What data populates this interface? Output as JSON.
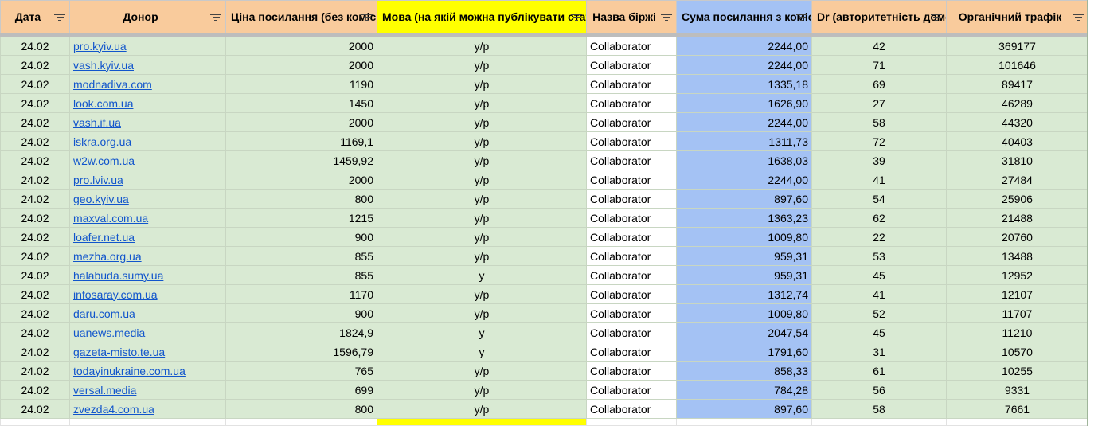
{
  "headers": [
    "Дата",
    "Донор",
    "Ціна посилання (без комісії біржі)",
    "Мова (на якій можна публікувати статті)",
    "Назва біржі",
    "Сума посилання з комісією біржі",
    "Dr (авторитетність домену)",
    "Органічний трафік"
  ],
  "header_colors": {
    "default": "#f9cb9c",
    "language": "#ffff00",
    "sum": "#a4c2f4"
  },
  "icons": {
    "column_filter": "filter-icon"
  },
  "rows": [
    [
      "24.02",
      "pro.kyiv.ua",
      "2000",
      "у/р",
      "Collaborator",
      "2244,00",
      "42",
      "369177"
    ],
    [
      "24.02",
      "vash.kyiv.ua",
      "2000",
      "у/р",
      "Collaborator",
      "2244,00",
      "71",
      "101646"
    ],
    [
      "24.02",
      "modnadiva.com",
      "1190",
      "у/р",
      "Collaborator",
      "1335,18",
      "69",
      "89417"
    ],
    [
      "24.02",
      "look.com.ua",
      "1450",
      "у/р",
      "Collaborator",
      "1626,90",
      "27",
      "46289"
    ],
    [
      "24.02",
      "vash.if.ua",
      "2000",
      "у/р",
      "Collaborator",
      "2244,00",
      "58",
      "44320"
    ],
    [
      "24.02",
      "iskra.org.ua",
      "1169,1",
      "у/р",
      "Collaborator",
      "1311,73",
      "72",
      "40403"
    ],
    [
      "24.02",
      "w2w.com.ua",
      "1459,92",
      "у/р",
      "Collaborator",
      "1638,03",
      "39",
      "31810"
    ],
    [
      "24.02",
      "pro.lviv.ua",
      "2000",
      "у/р",
      "Collaborator",
      "2244,00",
      "41",
      "27484"
    ],
    [
      "24.02",
      "geo.kyiv.ua",
      "800",
      "у/р",
      "Collaborator",
      "897,60",
      "54",
      "25906"
    ],
    [
      "24.02",
      "maxval.com.ua",
      "1215",
      "у/р",
      "Collaborator",
      "1363,23",
      "62",
      "21488"
    ],
    [
      "24.02",
      "loafer.net.ua",
      "900",
      "у/р",
      "Collaborator",
      "1009,80",
      "22",
      "20760"
    ],
    [
      "24.02",
      "mezha.org.ua",
      "855",
      "у/р",
      "Collaborator",
      "959,31",
      "53",
      "13488"
    ],
    [
      "24.02",
      "halabuda.sumy.ua",
      "855",
      "у",
      "Collaborator",
      "959,31",
      "45",
      "12952"
    ],
    [
      "24.02",
      "infosaray.com.ua",
      "1170",
      "у/р",
      "Collaborator",
      "1312,74",
      "41",
      "12107"
    ],
    [
      "24.02",
      "daru.com.ua",
      "900",
      "у/р",
      "Collaborator",
      "1009,80",
      "52",
      "11707"
    ],
    [
      "24.02",
      "uanews.media",
      "1824,9",
      "у",
      "Collaborator",
      "2047,54",
      "45",
      "11210"
    ],
    [
      "24.02",
      "gazeta-misto.te.ua",
      "1596,79",
      "у",
      "Collaborator",
      "1791,60",
      "31",
      "10570"
    ],
    [
      "24.02",
      "todayinukraine.com.ua",
      "765",
      "у/р",
      "Collaborator",
      "858,33",
      "61",
      "10255"
    ],
    [
      "24.02",
      "versal.media",
      "699",
      "у/р",
      "Collaborator",
      "784,28",
      "56",
      "9331"
    ],
    [
      "24.02",
      "zvezda4.com.ua",
      "800",
      "у/р",
      "Collaborator",
      "897,60",
      "58",
      "7661"
    ]
  ]
}
